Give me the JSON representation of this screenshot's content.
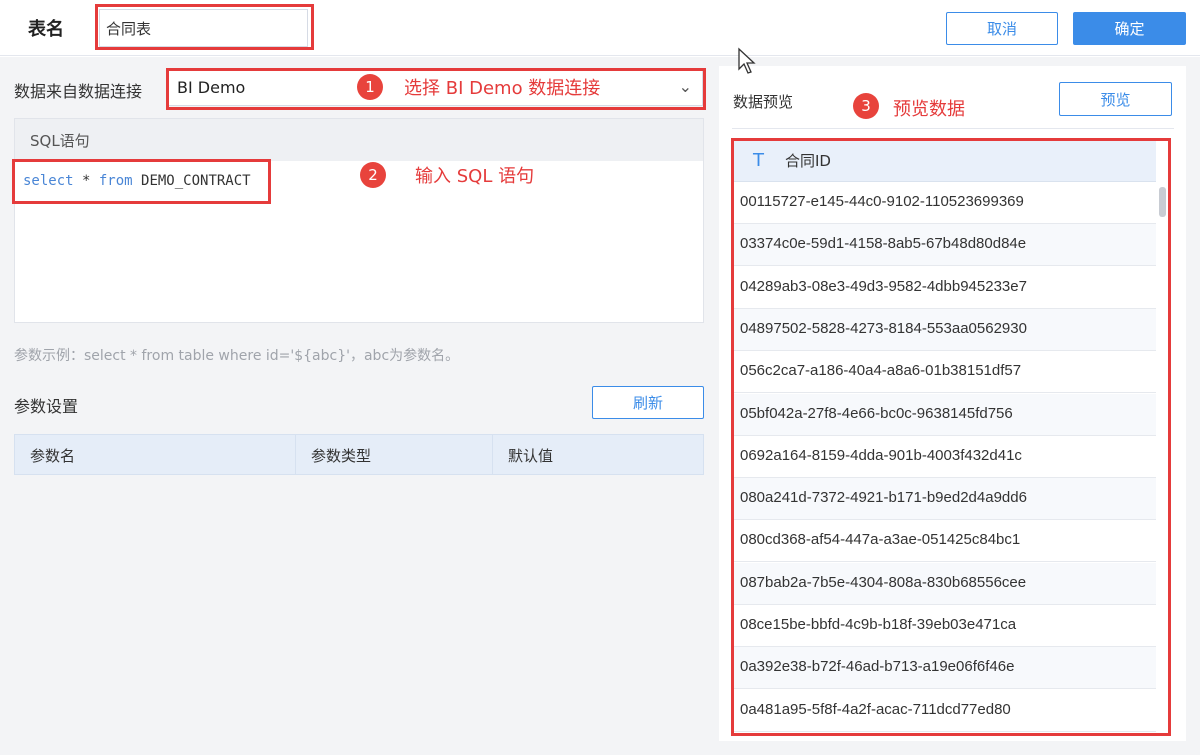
{
  "header": {
    "table_name_label": "表名",
    "table_name_value": "合同表",
    "cancel_label": "取消",
    "confirm_label": "确定"
  },
  "source": {
    "label": "数据来自数据连接",
    "selected_connection": "BI Demo"
  },
  "sql": {
    "title": "SQL语句",
    "code_keyword1": "select",
    "code_mid": " * ",
    "code_keyword2": "from",
    "code_table": " DEMO_CONTRACT"
  },
  "hint": "参数示例：select * from table where id='${abc}'，abc为参数名。",
  "params": {
    "title": "参数设置",
    "refresh_label": "刷新",
    "columns": [
      "参数名",
      "参数类型",
      "默认值"
    ]
  },
  "preview": {
    "title": "数据预览",
    "button_label": "预览",
    "column_type": "T",
    "column_name": "合同ID",
    "rows": [
      "00115727-e145-44c0-9102-110523699369",
      "03374c0e-59d1-4158-8ab5-67b48d80d84e",
      "04289ab3-08e3-49d3-9582-4dbb945233e7",
      "04897502-5828-4273-8184-553aa0562930",
      "056c2ca7-a186-40a4-a8a6-01b38151df57",
      "05bf042a-27f8-4e66-bc0c-9638145fd756",
      "0692a164-8159-4dda-901b-4003f432d41c",
      "080a241d-7372-4921-b171-b9ed2d4a9dd6",
      "080cd368-af54-447a-a3ae-051425c84bc1",
      "087bab2a-7b5e-4304-808a-830b68556cee",
      "08ce15be-bbfd-4c9b-b18f-39eb03e471ca",
      "0a392e38-b72f-46ad-b713-a19e06f6f46e",
      "0a481a95-5f8f-4a2f-acac-711dcd77ed80"
    ]
  },
  "annotations": {
    "n1": "1",
    "t1": "选择 BI Demo 数据连接",
    "n2": "2",
    "t2": "输入 SQL 语句",
    "n3": "3",
    "t3": "预览数据"
  },
  "colors": {
    "accent": "#3b8ce8",
    "annotation_red": "#e53b3b"
  }
}
